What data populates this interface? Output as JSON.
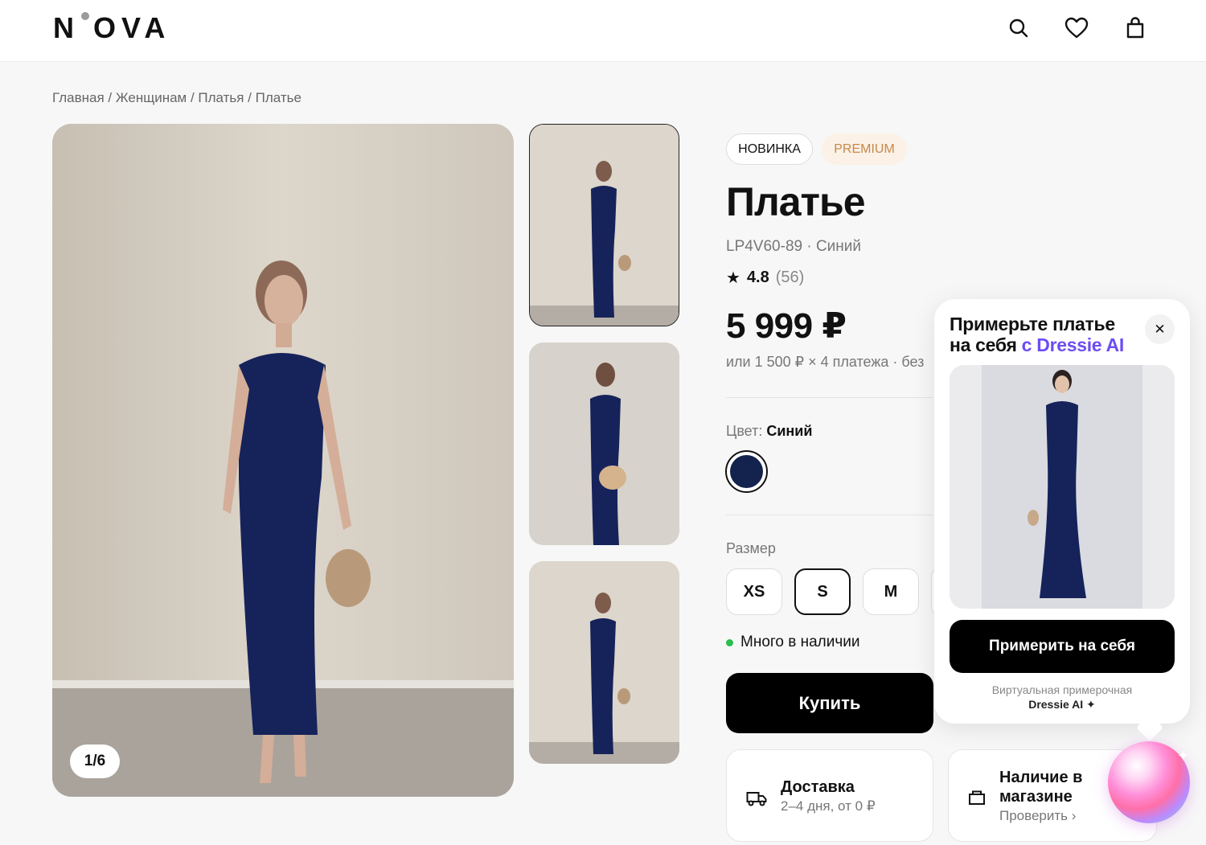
{
  "header": {
    "logo": "N OVA"
  },
  "breadcrumb": "Главная / Женщинам / Платья / Платье",
  "gallery": {
    "counter": "1/6"
  },
  "product": {
    "tags": [
      "НОВИНКА",
      "PREMIUM"
    ],
    "title": "Платье",
    "sku": "LP4V60-89 · Синий",
    "rating": "4.8",
    "reviews": "(56)",
    "price": "5 999 ₽",
    "installment": "или 1 500 ₽ × 4 платежа · без",
    "color_label": "Цвет:",
    "color_value": "Синий",
    "color_hex": "#14234d",
    "size_label": "Размер",
    "sizes": [
      "XS",
      "S",
      "M"
    ],
    "selected_size": "S",
    "stock": "Много в наличии",
    "buy_label": "Купить"
  },
  "cards": {
    "delivery_title": "Доставка",
    "delivery_sub": "2–4 дня, от 0 ₽",
    "store_title": "Наличие в магазине",
    "store_sub": "Проверить ›"
  },
  "popup": {
    "title_line1": "Примерьте платье",
    "title_line2": "на себя",
    "title_brand": "с Dressie AI",
    "try_label": "Примерить на себя",
    "note": "Виртуальная примерочная",
    "brand": "Dressie AI ✦"
  },
  "colors": {
    "accent_purple": "#6d4df2",
    "premium": "#c6884a",
    "stock_green": "#2dbd4e"
  }
}
